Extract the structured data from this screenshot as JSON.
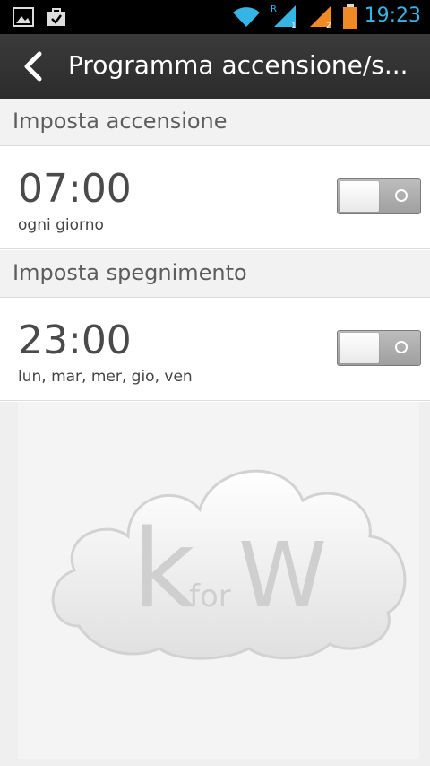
{
  "status_bar": {
    "time": "19:23",
    "icons": [
      "gallery-icon",
      "bag-check-icon",
      "wifi-icon",
      "signal-sim1-icon",
      "signal-sim2-icon",
      "battery-icon"
    ],
    "accent_color": "#34b5e5"
  },
  "action_bar": {
    "title": "Programma accensione/s..."
  },
  "power_on": {
    "header": "Imposta accensione",
    "time": "07:00",
    "days": "ogni giorno",
    "enabled": false
  },
  "power_off": {
    "header": "Imposta spegnimento",
    "time": "23:00",
    "days": "lun, mar, mer, gio, ven",
    "enabled": false
  },
  "watermark": {
    "k": "k",
    "for": "for",
    "w": "W"
  }
}
